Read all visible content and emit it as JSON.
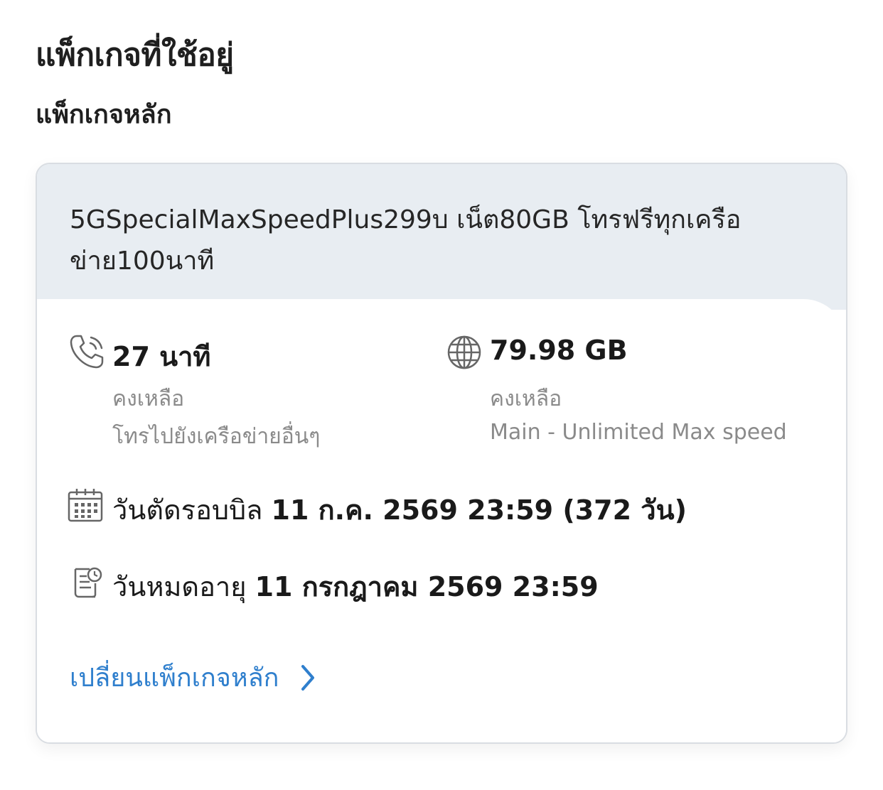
{
  "page": {
    "title": "แพ็กเกจที่ใช้อยู่",
    "section_title": "แพ็กเกจหลัก"
  },
  "package": {
    "name": "5GSpecialMaxSpeedPlus299บ เน็ต80GB โทรฟรีทุกเครือข่าย100นาที",
    "voice": {
      "icon": "phone-icon",
      "amount": "27 นาที",
      "remaining_label": "คงเหลือ",
      "description": "โทรไปยังเครือข่ายอื่นๆ"
    },
    "data": {
      "icon": "globe-icon",
      "amount": "79.98 GB",
      "remaining_label": "คงเหลือ",
      "description": "Main - Unlimited Max speed"
    },
    "billing": {
      "icon": "calendar-icon",
      "label": "วันตัดรอบบิล",
      "value": "11 ก.ค. 2569 23:59 (372 วัน)"
    },
    "expiry": {
      "icon": "document-clock-icon",
      "label": "วันหมดอายุ",
      "value": "11 กรกฎาคม 2569 23:59"
    },
    "change_link": {
      "label": "เปลี่ยนแพ็กเกจหลัก",
      "icon": "chevron-right-icon",
      "color": "#2f7fcd"
    }
  }
}
